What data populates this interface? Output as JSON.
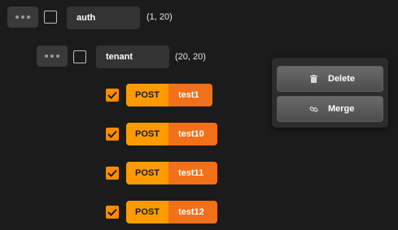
{
  "tree": {
    "root": {
      "name": "auth",
      "coords": "(1, 20)"
    },
    "child": {
      "name": "tenant",
      "coords": "(20, 20)"
    },
    "requests": [
      {
        "method": "POST",
        "name": "test1"
      },
      {
        "method": "POST",
        "name": "test10"
      },
      {
        "method": "POST",
        "name": "test11"
      },
      {
        "method": "POST",
        "name": "test12"
      }
    ]
  },
  "context_menu": {
    "delete_label": "Delete",
    "delete_icon": "trash-icon",
    "merge_label": "Merge",
    "merge_icon": "link-icon"
  },
  "colors": {
    "method_bg": "#ff9b00",
    "name_bg": "#f27018",
    "checkbox_checked": "#ff8c00"
  }
}
